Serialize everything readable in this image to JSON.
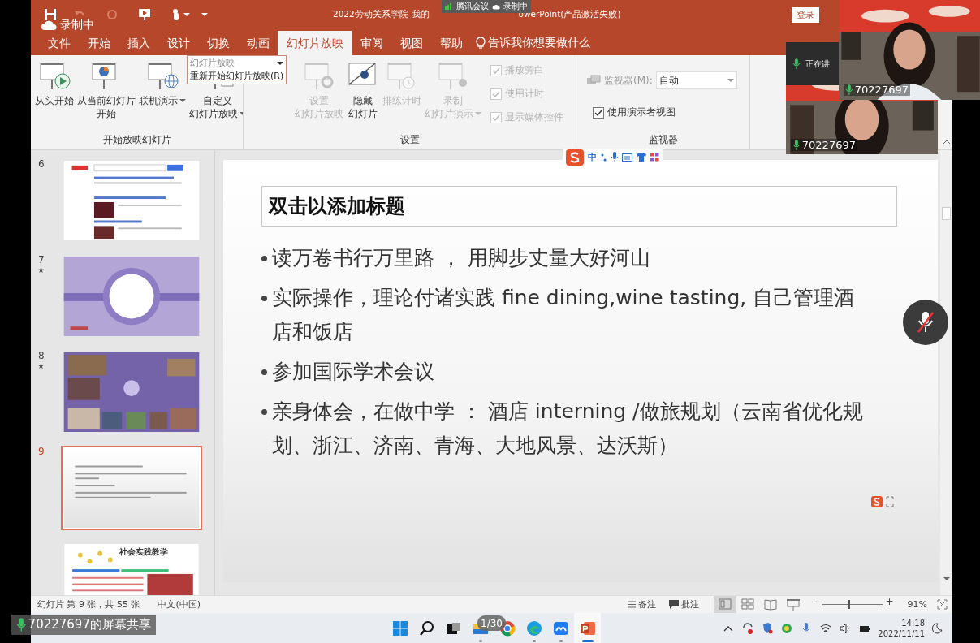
{
  "title_bar": {
    "title": "2022劳动关系学院-我的",
    "title_tail": "owerPoint(产品激活失败)",
    "login_button": "登录"
  },
  "meeting_badge": {
    "app": "腾讯会议",
    "recording": "录制中"
  },
  "recording_label": "录制中",
  "tabs": [
    {
      "label": "文件",
      "selected": false
    },
    {
      "label": "开始",
      "selected": false
    },
    {
      "label": "插入",
      "selected": false
    },
    {
      "label": "设计",
      "selected": false
    },
    {
      "label": "切换",
      "selected": false
    },
    {
      "label": "动画",
      "selected": false
    },
    {
      "label": "幻灯片放映",
      "selected": true
    },
    {
      "label": "审阅",
      "selected": false
    },
    {
      "label": "视图",
      "selected": false
    },
    {
      "label": "帮助",
      "selected": false
    }
  ],
  "tell_me": "告诉我你想要做什么",
  "ribbon": {
    "groups": [
      {
        "label": "开始放映幻灯片",
        "buttons": [
          {
            "lines": [
              "从头开始"
            ],
            "kind": "play",
            "disabled": false,
            "dropdown": false
          },
          {
            "lines": [
              "从当前幻灯片",
              "开始"
            ],
            "kind": "current",
            "disabled": false,
            "dropdown": false
          },
          {
            "lines": [
              "联机演示"
            ],
            "kind": "online",
            "disabled": false,
            "dropdown": true
          },
          {
            "lines": [
              "自定义",
              "幻灯片放映"
            ],
            "kind": "custom",
            "disabled": false,
            "dropdown": true
          }
        ]
      },
      {
        "label": "设置",
        "buttons": [
          {
            "lines": [
              "设置",
              "幻灯片放映"
            ],
            "kind": "setup",
            "disabled": true,
            "dropdown": false
          },
          {
            "lines": [
              "隐藏",
              "幻灯片"
            ],
            "kind": "hide",
            "disabled": false,
            "dropdown": false
          },
          {
            "lines": [
              "排练计时"
            ],
            "kind": "rehearse",
            "disabled": true,
            "dropdown": false
          },
          {
            "lines": [
              "录制",
              "幻灯片演示"
            ],
            "kind": "record",
            "disabled": true,
            "dropdown": true
          }
        ],
        "checkboxes": [
          {
            "label": "播放旁白",
            "checked": true,
            "disabled": true
          },
          {
            "label": "使用计时",
            "checked": true,
            "disabled": true
          },
          {
            "label": "显示媒体控件",
            "checked": true,
            "disabled": true
          }
        ]
      },
      {
        "label": "监视器",
        "monitor": {
          "label": "监视器(M):",
          "value": "自动"
        },
        "checkboxes": [
          {
            "label": "使用演示者视图",
            "checked": true,
            "disabled": false
          }
        ]
      }
    ]
  },
  "tooltip": {
    "title": "幻灯片放映",
    "item": "重新开始幻灯片放映(R)"
  },
  "thumbnails": [
    {
      "number": "6",
      "kind": "web",
      "animated": false,
      "selected": false
    },
    {
      "number": "7",
      "kind": "section",
      "animated": true,
      "selected": false
    },
    {
      "number": "8",
      "kind": "collage",
      "animated": true,
      "selected": false
    },
    {
      "number": "9",
      "kind": "bullets",
      "animated": false,
      "selected": true
    },
    {
      "kind": "table",
      "title": "社会实践教学",
      "animated": false,
      "selected": false
    }
  ],
  "slide": {
    "title": "双击以添加标题",
    "bullets": [
      "读万卷书行万里路 ， 用脚步丈量大好河山",
      "实际操作，理论付诸实践  fine dining,wine tasting, 自己管理酒店和饭店",
      "参加国际学术会议",
      "亲身体会，在做中学 ： 酒店 interning /做旅规划（云南省优化规划、浙江、济南、青海、大地风景、达沃斯）"
    ]
  },
  "ime_toolbar": {
    "mode": "中"
  },
  "status_bar": {
    "slide_info": "幻灯片 第 9 张，共 55 张",
    "language": "中文(中国)",
    "notes": "备注",
    "comments": "批注",
    "views": [
      {
        "kind": "normal",
        "selected": true
      },
      {
        "kind": "sorter",
        "selected": false
      },
      {
        "kind": "reading",
        "selected": false
      },
      {
        "kind": "show",
        "selected": false
      }
    ],
    "zoom_minus": "−",
    "zoom_plus": "+",
    "zoom": {
      "level": 0.43
    },
    "zoom_percent": "91%"
  },
  "taskbar": {
    "apps": [
      {
        "kind": "start",
        "running": false,
        "active": false
      },
      {
        "kind": "search",
        "running": false,
        "active": false
      },
      {
        "kind": "taskview",
        "running": false,
        "active": false
      },
      {
        "kind": "folder",
        "running": true,
        "active": false
      },
      {
        "kind": "chrome",
        "running": false,
        "active": false
      },
      {
        "kind": "edge",
        "running": true,
        "active": false
      },
      {
        "kind": "meeting",
        "running": true,
        "active": false
      },
      {
        "kind": "powerpoint",
        "running": true,
        "active": true
      }
    ],
    "time": "14:18",
    "date": "2022/11/11"
  },
  "videos": [
    {
      "label": "70227697"
    },
    {
      "label": "70227697"
    }
  ],
  "speaker_header": "正在讲",
  "mic_button": {
    "muted": true
  },
  "share_label": "70227697的屏幕共享",
  "page_badge": "1/30"
}
